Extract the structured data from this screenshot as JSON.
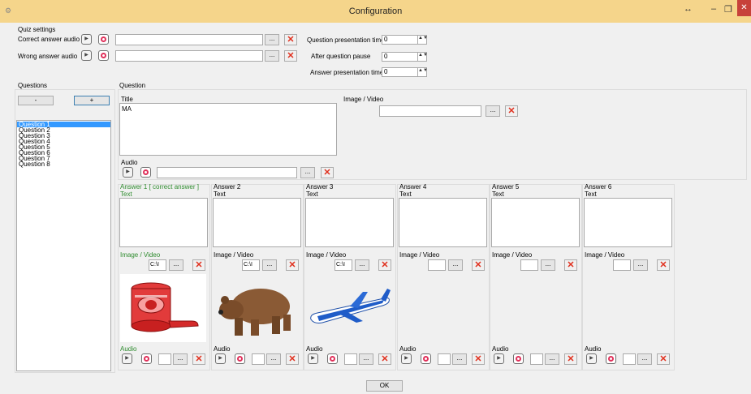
{
  "window": {
    "title": "Configuration",
    "move_glyph": "↔",
    "min_glyph": "‒",
    "restore_glyph": "❐",
    "close_glyph": "✕"
  },
  "quiz": {
    "group_label": "Quiz settings",
    "correct_label": "Correct answer audio",
    "wrong_label": "Wrong answer audio",
    "correct_path": "",
    "wrong_path": "",
    "qpt_label": "Question presentation time",
    "qpt_value": "0",
    "aqp_label": "After question pause",
    "aqp_value": "0",
    "apt_label": "Answer presentation time",
    "apt_value": "0"
  },
  "questions": {
    "label": "Questions",
    "remove_label": "-",
    "add_label": "+",
    "items": [
      "Question 1",
      "Question 2",
      "Question 3",
      "Question 4",
      "Question 5",
      "Question 6",
      "Question 7",
      "Question 8"
    ],
    "selected_index": 0
  },
  "question": {
    "label": "Question",
    "title_label": "Title",
    "title_value": "MA",
    "image_label": "Image / Video",
    "image_path": "",
    "audio_label": "Audio",
    "audio_path": ""
  },
  "answers": [
    {
      "header": "Answer 1 [ correct answer ]",
      "correct": true,
      "text_label": "Text",
      "text_value": "",
      "image_label": "Image / Video",
      "image_path": "",
      "media_kind": "",
      "audio_label": "Audio"
    },
    {
      "header": "Answer 2",
      "correct": false,
      "text_label": "Text",
      "text_value": "",
      "image_label": "Image / Video",
      "image_path": "C:\\I",
      "media_kind": "bear",
      "audio_label": "Audio"
    },
    {
      "header": "Answer 3",
      "correct": false,
      "text_label": "Text",
      "text_value": "",
      "image_label": "Image / Video",
      "image_path": "C:\\I",
      "media_kind": "plane",
      "audio_label": "Audio"
    },
    {
      "header": "Answer 4",
      "correct": false,
      "text_label": "Text",
      "text_value": "",
      "image_label": "Image / Video",
      "image_path": "",
      "media_kind": "",
      "audio_label": "Audio"
    },
    {
      "header": "Answer 5",
      "correct": false,
      "text_label": "Text",
      "text_value": "",
      "image_label": "Image / Video",
      "image_path": "",
      "media_kind": "",
      "audio_label": "Audio"
    },
    {
      "header": "Answer 6",
      "correct": false,
      "text_label": "Text",
      "text_value": "",
      "image_label": "Image / Video",
      "image_path": "",
      "media_kind": "",
      "audio_label": "Audio"
    }
  ],
  "answer1_image_path": "C:\\I",
  "answer1_media_kind": "red-device",
  "common": {
    "browse_label": "...",
    "clear_glyph": "✕",
    "play_glyph": "▶",
    "spin_glyph": "▲▼"
  },
  "footer": {
    "ok_label": "OK"
  },
  "colors": {
    "titlebar": "#f5d58b",
    "selection": "#3399ff",
    "correct_answer": "#2e8b2e",
    "clear_icon": "#e0301e",
    "record_icon": "#e0305a"
  }
}
